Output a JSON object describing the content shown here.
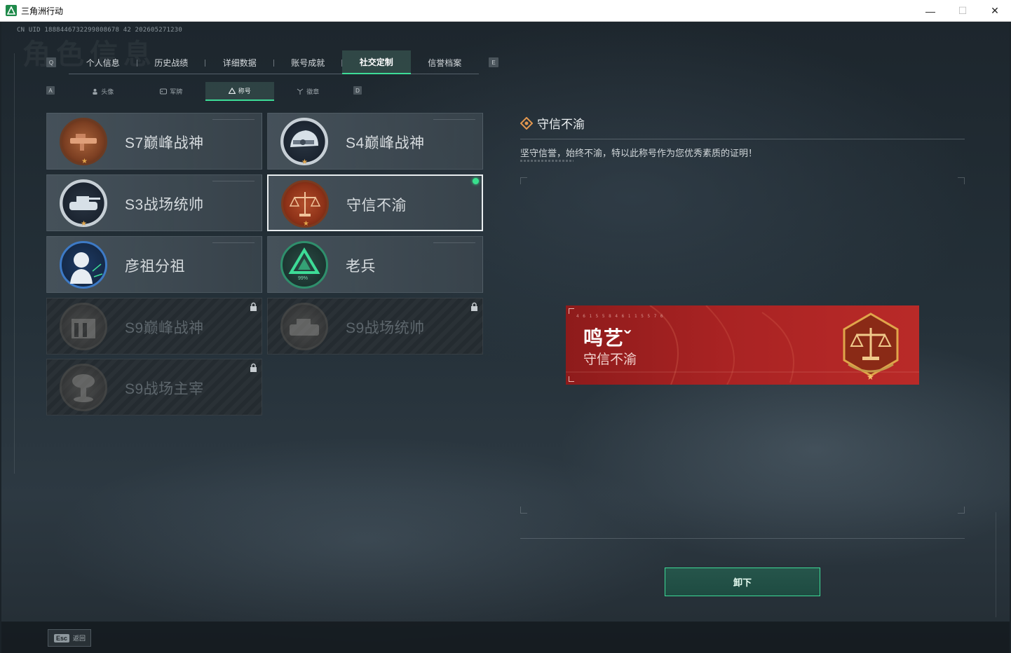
{
  "window": {
    "title": "三角洲行动",
    "minimize": "—",
    "maximize": "☐",
    "close": "✕"
  },
  "header": {
    "uid": "CN UID 1888446732299808678 42 202605271230",
    "bg_title": "角色信息"
  },
  "main_tabs": {
    "prev_key": "Q",
    "next_key": "E",
    "items": [
      {
        "label": "个人信息"
      },
      {
        "label": "历史战绩"
      },
      {
        "label": "详细数据"
      },
      {
        "label": "账号成就"
      },
      {
        "label": "社交定制",
        "active": true
      },
      {
        "label": "信誉档案"
      }
    ]
  },
  "sub_tabs": {
    "prev_key": "A",
    "next_key": "D",
    "items": [
      {
        "label": "头像",
        "icon": "person-icon"
      },
      {
        "label": "军牌",
        "icon": "dogtag-icon"
      },
      {
        "label": "称号",
        "icon": "triangle-icon",
        "active": true
      },
      {
        "label": "徽章",
        "icon": "badge-icon"
      }
    ]
  },
  "titles": [
    {
      "label": "S7巅峰战神",
      "emblem": "copper-weapon-emblem",
      "state": "unlocked"
    },
    {
      "label": "S4巅峰战神",
      "emblem": "helmet-emblem",
      "state": "unlocked"
    },
    {
      "label": "S3战场统帅",
      "emblem": "tank-emblem",
      "state": "unlocked"
    },
    {
      "label": "守信不渝",
      "emblem": "scales-emblem",
      "state": "selected-equipped"
    },
    {
      "label": "彦祖分祖",
      "emblem": "portrait-emblem",
      "state": "unlocked"
    },
    {
      "label": "老兵",
      "emblem": "veteran-emblem",
      "state": "unlocked",
      "emblem_text": "99%"
    },
    {
      "label": "S9巅峰战神",
      "emblem": "fortress-emblem",
      "state": "locked"
    },
    {
      "label": "S9战场统帅",
      "emblem": "armored-emblem",
      "state": "locked"
    },
    {
      "label": "S9战场主宰",
      "emblem": "mushroom-cloud-emblem",
      "state": "locked"
    }
  ],
  "detail": {
    "title": "守信不渝",
    "description": "坚守信誉，始终不渝，特以此称号作为您优秀素质的证明！"
  },
  "nameplate": {
    "player_name": "鸣艺ˇ",
    "title": "守信不渝",
    "code": "4 6  1 5 5 8 4     6 1  1 5 5 7 6"
  },
  "actions": {
    "unequip": "卸下",
    "esc_key": "Esc",
    "esc_label": "返回"
  },
  "colors": {
    "accent": "#3ddc97",
    "banner_red": "#a92323",
    "background": "#243038"
  }
}
